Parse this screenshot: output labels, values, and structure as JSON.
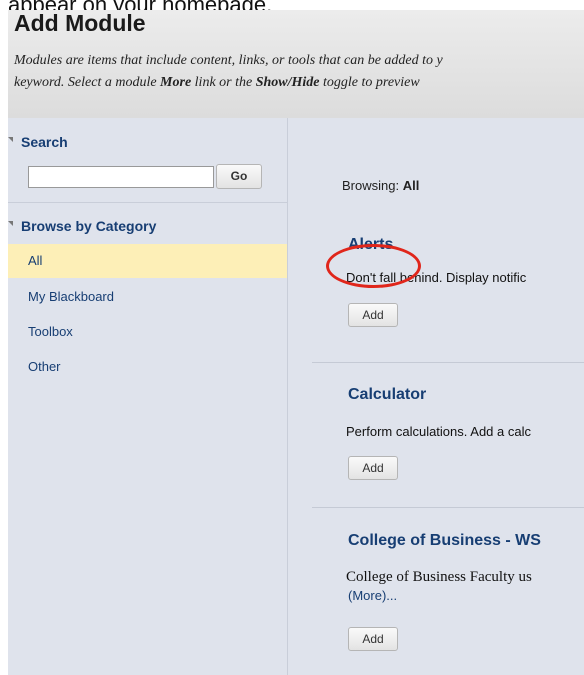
{
  "doc_text": "appear on your homepage.",
  "header": {
    "title": "Add Module",
    "intro_line1_a": "Modules are items that include content, links, or tools that can be added to y",
    "intro_line2_a": "keyword. Select a module ",
    "intro_line2_more": "More",
    "intro_line2_b": " link or the ",
    "intro_line2_showhide": "Show/Hide",
    "intro_line2_c": " toggle to preview"
  },
  "sidebar": {
    "search_heading": "Search",
    "search_value": "",
    "go_label": "Go",
    "browse_heading": "Browse by Category",
    "categories": [
      {
        "label": "All",
        "selected": true
      },
      {
        "label": "My Blackboard",
        "selected": false
      },
      {
        "label": "Toolbox",
        "selected": false
      },
      {
        "label": "Other",
        "selected": false
      }
    ]
  },
  "main": {
    "browsing_prefix": "Browsing: ",
    "browsing_value": "All",
    "modules": [
      {
        "title": "Alerts",
        "description": "Don't fall behind. Display notific",
        "add_label": "Add"
      },
      {
        "title": "Calculator",
        "description": "Perform calculations. Add a calc",
        "add_label": "Add"
      },
      {
        "title": "College of Business - WS",
        "description": "College of Business Faculty us",
        "more_label": "(More)...",
        "add_label": "Add"
      }
    ]
  },
  "colors": {
    "link_blue": "#173e73",
    "panel_bg": "#dfe3ec",
    "selected_bg": "#fdefb7",
    "highlight_red": "#e0261b"
  }
}
